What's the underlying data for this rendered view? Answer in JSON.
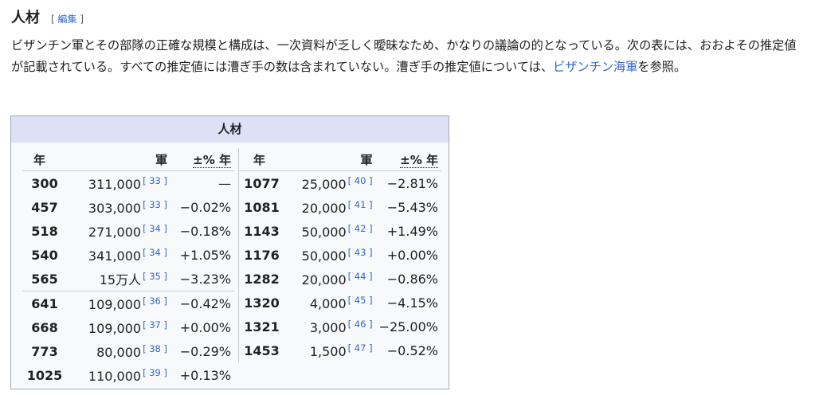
{
  "section": {
    "title": "人材",
    "edit_open": "[",
    "edit_label": "編集",
    "edit_close": "]"
  },
  "paragraph": {
    "text_before": "ビザンチン軍とその部隊の正確な規模と構成は、一次資料が乏しく曖昧なため、かなりの議論の的となっている。次の表には、おおよその推定値が記載されている。すべての推定値には漕ぎ手の数は含まれていない。漕ぎ手の推定値については、",
    "link": "ビザンチン海軍",
    "text_after": "を参照。"
  },
  "infobox": {
    "title": "人材",
    "headers": {
      "year": "年",
      "army": "軍",
      "pct": "±% 年"
    },
    "left_rows": [
      {
        "year": "300",
        "army": "311,000",
        "ref": "[ 33 ]",
        "pct": "—"
      },
      {
        "year": "457",
        "army": "303,000",
        "ref": "[ 33 ]",
        "pct": "−0.02%"
      },
      {
        "year": "518",
        "army": "271,000",
        "ref": "[ 34 ]",
        "pct": "−0.18%"
      },
      {
        "year": "540",
        "army": "341,000",
        "ref": "[ 34 ]",
        "pct": "+1.05%"
      },
      {
        "year": "565",
        "army": "15万人",
        "ref": "[ 35 ]",
        "pct": "−3.23%"
      },
      {
        "year": "641",
        "army": "109,000",
        "ref": "[ 36 ]",
        "pct": "−0.42%"
      },
      {
        "year": "668",
        "army": "109,000",
        "ref": "[ 37 ]",
        "pct": "+0.00%"
      },
      {
        "year": "773",
        "army": "80,000",
        "ref": "[ 38 ]",
        "pct": "−0.29%"
      },
      {
        "year": "1025",
        "army": "110,000",
        "ref": "[ 39 ]",
        "pct": "+0.13%"
      }
    ],
    "right_rows": [
      {
        "year": "1077",
        "army": "25,000",
        "ref": "[ 40 ]",
        "pct": "−2.81%"
      },
      {
        "year": "1081",
        "army": "20,000",
        "ref": "[ 41 ]",
        "pct": "−5.43%"
      },
      {
        "year": "1143",
        "army": "50,000",
        "ref": "[ 42 ]",
        "pct": "+1.49%"
      },
      {
        "year": "1176",
        "army": "50,000",
        "ref": "[ 43 ]",
        "pct": "+0.00%"
      },
      {
        "year": "1282",
        "army": "20,000",
        "ref": "[ 44 ]",
        "pct": "−0.86%"
      },
      {
        "year": "1320",
        "army": "4,000",
        "ref": "[ 45 ]",
        "pct": "−4.15%"
      },
      {
        "year": "1321",
        "army": "3,000",
        "ref": "[ 46 ]",
        "pct": "−25.00%"
      },
      {
        "year": "1453",
        "army": "1,500",
        "ref": "[ 47 ]",
        "pct": "−0.52%"
      }
    ]
  }
}
